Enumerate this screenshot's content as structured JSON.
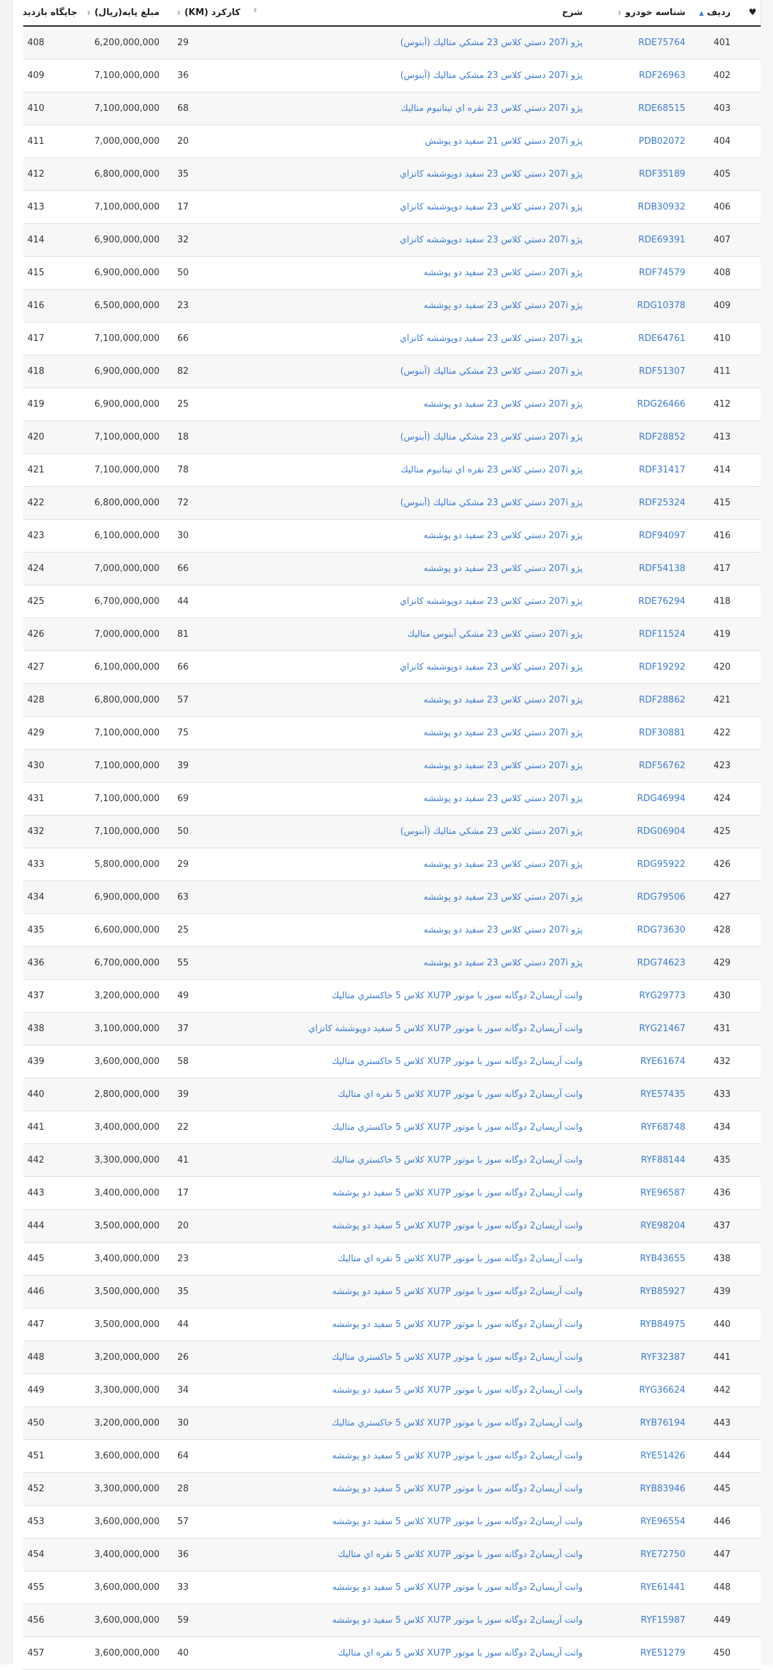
{
  "header": {
    "fav": "♥",
    "index": "ردیف",
    "code": "شناسه خودرو",
    "desc": "شرح",
    "km": "کارکرد (KM)",
    "price": "مبلغ پایه(ریال)",
    "rank": "جایگاه بازدید"
  },
  "colors": {
    "link": "#3a7bd5",
    "active_sort": "#3b7ad8"
  },
  "rows": [
    {
      "index": "401",
      "code": "RDE75764",
      "desc": "پژو 207i دستي كلاس 23 مشكي متاليك (آبنوس)",
      "km": "29",
      "price": "6,200,000,000",
      "rank": "408"
    },
    {
      "index": "402",
      "code": "RDF26963",
      "desc": "پژو 207i دستي كلاس 23 مشكي متاليك (آبنوس)",
      "km": "36",
      "price": "7,100,000,000",
      "rank": "409"
    },
    {
      "index": "403",
      "code": "RDE68515",
      "desc": "پژو 207i دستي كلاس 23 نقره اي تيتانيوم متاليك",
      "km": "68",
      "price": "7,100,000,000",
      "rank": "410"
    },
    {
      "index": "404",
      "code": "PDB02072",
      "desc": "پژو 207i دستي كلاس 21 سفيد دو پوشش",
      "km": "20",
      "price": "7,000,000,000",
      "rank": "411"
    },
    {
      "index": "405",
      "code": "RDF35189",
      "desc": "پژو 207i دستي كلاس 23 سفيد دوپوششه كانزاي",
      "km": "35",
      "price": "6,800,000,000",
      "rank": "412"
    },
    {
      "index": "406",
      "code": "RDB30932",
      "desc": "پژو 207i دستي كلاس 23 سفيد دوپوششه كانزاي",
      "km": "17",
      "price": "7,100,000,000",
      "rank": "413"
    },
    {
      "index": "407",
      "code": "RDE69391",
      "desc": "پژو 207i دستي كلاس 23 سفيد دوپوششه كانزاي",
      "km": "32",
      "price": "6,900,000,000",
      "rank": "414"
    },
    {
      "index": "408",
      "code": "RDF74579",
      "desc": "پژو 207i دستي كلاس 23 سفيد دو پوششه",
      "km": "50",
      "price": "6,900,000,000",
      "rank": "415"
    },
    {
      "index": "409",
      "code": "RDG10378",
      "desc": "پژو 207i دستي كلاس 23 سفيد دو پوششه",
      "km": "23",
      "price": "6,500,000,000",
      "rank": "416"
    },
    {
      "index": "410",
      "code": "RDE64761",
      "desc": "پژو 207i دستي كلاس 23 سفيد دوپوششه كانزاي",
      "km": "66",
      "price": "7,100,000,000",
      "rank": "417"
    },
    {
      "index": "411",
      "code": "RDF51307",
      "desc": "پژو 207i دستي كلاس 23 مشكي متاليك (آبنوس)",
      "km": "82",
      "price": "6,900,000,000",
      "rank": "418"
    },
    {
      "index": "412",
      "code": "RDG26466",
      "desc": "پژو 207i دستي كلاس 23 سفيد دو پوششه",
      "km": "25",
      "price": "6,900,000,000",
      "rank": "419"
    },
    {
      "index": "413",
      "code": "RDF28852",
      "desc": "پژو 207i دستي كلاس 23 مشكي متاليك (آبنوس)",
      "km": "18",
      "price": "7,100,000,000",
      "rank": "420"
    },
    {
      "index": "414",
      "code": "RDF31417",
      "desc": "پژو 207i دستي كلاس 23 نقره اي تيتانيوم متاليك",
      "km": "78",
      "price": "7,100,000,000",
      "rank": "421"
    },
    {
      "index": "415",
      "code": "RDF25324",
      "desc": "پژو 207i دستي كلاس 23 مشكي متاليك (آبنوس)",
      "km": "72",
      "price": "6,800,000,000",
      "rank": "422"
    },
    {
      "index": "416",
      "code": "RDF94097",
      "desc": "پژو 207i دستي كلاس 23 سفيد دو پوششه",
      "km": "30",
      "price": "6,100,000,000",
      "rank": "423"
    },
    {
      "index": "417",
      "code": "RDF54138",
      "desc": "پژو 207i دستي كلاس 23 سفيد دو پوششه",
      "km": "66",
      "price": "7,000,000,000",
      "rank": "424"
    },
    {
      "index": "418",
      "code": "RDE76294",
      "desc": "پژو 207i دستي كلاس 23 سفيد دوپوششه كانزاي",
      "km": "44",
      "price": "6,700,000,000",
      "rank": "425"
    },
    {
      "index": "419",
      "code": "RDF11524",
      "desc": "پژو 207i دستي كلاس 23 مشكي آبنوس متاليك",
      "km": "81",
      "price": "7,000,000,000",
      "rank": "426"
    },
    {
      "index": "420",
      "code": "RDF19292",
      "desc": "پژو 207i دستي كلاس 23 سفيد دوپوششه كانزاي",
      "km": "66",
      "price": "6,100,000,000",
      "rank": "427"
    },
    {
      "index": "421",
      "code": "RDF28862",
      "desc": "پژو 207i دستي كلاس 23 سفيد دو پوششه",
      "km": "57",
      "price": "6,800,000,000",
      "rank": "428"
    },
    {
      "index": "422",
      "code": "RDF30881",
      "desc": "پژو 207i دستي كلاس 23 سفيد دو پوششه",
      "km": "75",
      "price": "7,100,000,000",
      "rank": "429"
    },
    {
      "index": "423",
      "code": "RDF56762",
      "desc": "پژو 207i دستي كلاس 23 سفيد دو پوششه",
      "km": "39",
      "price": "7,100,000,000",
      "rank": "430"
    },
    {
      "index": "424",
      "code": "RDG46994",
      "desc": "پژو 207i دستي كلاس 23 سفيد دو پوششه",
      "km": "69",
      "price": "7,100,000,000",
      "rank": "431"
    },
    {
      "index": "425",
      "code": "RDG06904",
      "desc": "پژو 207i دستي كلاس 23 مشكي متاليك (آبنوس)",
      "km": "50",
      "price": "7,100,000,000",
      "rank": "432"
    },
    {
      "index": "426",
      "code": "RDG95922",
      "desc": "پژو 207i دستي كلاس 23 سفيد دو پوششه",
      "km": "29",
      "price": "5,800,000,000",
      "rank": "433"
    },
    {
      "index": "427",
      "code": "RDG79506",
      "desc": "پژو 207i دستي كلاس 23 سفيد دو پوششه",
      "km": "63",
      "price": "6,900,000,000",
      "rank": "434"
    },
    {
      "index": "428",
      "code": "RDG73630",
      "desc": "پژو 207i دستي كلاس 23 سفيد دو پوششه",
      "km": "25",
      "price": "6,600,000,000",
      "rank": "435"
    },
    {
      "index": "429",
      "code": "RDG74623",
      "desc": "پژو 207i دستي كلاس 23 سفيد دو پوششه",
      "km": "55",
      "price": "6,700,000,000",
      "rank": "436"
    },
    {
      "index": "430",
      "code": "RYG29773",
      "desc": "وانت آريسان2 دوگانه سوز با موتور XU7P كلاس 5 خاكستري متاليك",
      "km": "49",
      "price": "3,200,000,000",
      "rank": "437"
    },
    {
      "index": "431",
      "code": "RYG21467",
      "desc": "وانت آريسان2 دوگانه سوز با موتور XU7P كلاس 5 سفيد دوپوششه كانزاي",
      "km": "37",
      "price": "3,100,000,000",
      "rank": "438"
    },
    {
      "index": "432",
      "code": "RYE61674",
      "desc": "وانت آريسان2 دوگانه سوز با موتور XU7P كلاس 5 خاكستري متاليك",
      "km": "58",
      "price": "3,600,000,000",
      "rank": "439"
    },
    {
      "index": "433",
      "code": "RYE57435",
      "desc": "وانت آريسان2 دوگانه سوز با موتور XU7P كلاس 5 نقره اي متاليك",
      "km": "39",
      "price": "2,800,000,000",
      "rank": "440"
    },
    {
      "index": "434",
      "code": "RYF68748",
      "desc": "وانت آريسان2 دوگانه سوز با موتور XU7P كلاس 5 خاكستري متاليك",
      "km": "22",
      "price": "3,400,000,000",
      "rank": "441"
    },
    {
      "index": "435",
      "code": "RYF88144",
      "desc": "وانت آريسان2 دوگانه سوز با موتور XU7P كلاس 5 خاكستري متاليك",
      "km": "41",
      "price": "3,300,000,000",
      "rank": "442"
    },
    {
      "index": "436",
      "code": "RYE96587",
      "desc": "وانت آريسان2 دوگانه سوز با موتور XU7P كلاس 5 سفيد دو پوششه",
      "km": "17",
      "price": "3,400,000,000",
      "rank": "443"
    },
    {
      "index": "437",
      "code": "RYE98204",
      "desc": "وانت آريسان2 دوگانه سوز با موتور XU7P كلاس 5 سفيد دو پوششه",
      "km": "20",
      "price": "3,500,000,000",
      "rank": "444"
    },
    {
      "index": "438",
      "code": "RYB43655",
      "desc": "وانت آريسان2 دوگانه سوز با موتور XU7P كلاس 5 نقره اي متاليك",
      "km": "23",
      "price": "3,400,000,000",
      "rank": "445"
    },
    {
      "index": "439",
      "code": "RYB85927",
      "desc": "وانت آريسان2 دوگانه سوز با موتور XU7P كلاس 5 سفيد دو پوششه",
      "km": "35",
      "price": "3,500,000,000",
      "rank": "446"
    },
    {
      "index": "440",
      "code": "RYB84975",
      "desc": "وانت آريسان2 دوگانه سوز با موتور XU7P كلاس 5 سفيد دو پوششه",
      "km": "44",
      "price": "3,500,000,000",
      "rank": "447"
    },
    {
      "index": "441",
      "code": "RYF32387",
      "desc": "وانت آريسان2 دوگانه سوز با موتور XU7P كلاس 5 خاكستري متاليك",
      "km": "26",
      "price": "3,200,000,000",
      "rank": "448"
    },
    {
      "index": "442",
      "code": "RYG36624",
      "desc": "وانت آريسان2 دوگانه سوز با موتور XU7P كلاس 5 سفيد دو پوششه",
      "km": "34",
      "price": "3,300,000,000",
      "rank": "449"
    },
    {
      "index": "443",
      "code": "RYB76194",
      "desc": "وانت آريسان2 دوگانه سوز با موتور XU7P كلاس 5 خاكستري متاليك",
      "km": "30",
      "price": "3,200,000,000",
      "rank": "450"
    },
    {
      "index": "444",
      "code": "RYE51426",
      "desc": "وانت آريسان2 دوگانه سوز با موتور XU7P كلاس 5 سفيد دو پوششه",
      "km": "64",
      "price": "3,600,000,000",
      "rank": "451"
    },
    {
      "index": "445",
      "code": "RYB83946",
      "desc": "وانت آريسان2 دوگانه سوز با موتور XU7P كلاس 5 سفيد دو پوششه",
      "km": "28",
      "price": "3,300,000,000",
      "rank": "452"
    },
    {
      "index": "446",
      "code": "RYE96554",
      "desc": "وانت آريسان2 دوگانه سوز با موتور XU7P كلاس 5 سفيد دو پوششه",
      "km": "57",
      "price": "3,600,000,000",
      "rank": "453"
    },
    {
      "index": "447",
      "code": "RYE72750",
      "desc": "وانت آريسان2 دوگانه سوز با موتور XU7P كلاس 5 نقره اي متاليك",
      "km": "36",
      "price": "3,400,000,000",
      "rank": "454"
    },
    {
      "index": "448",
      "code": "RYE61441",
      "desc": "وانت آريسان2 دوگانه سوز با موتور XU7P كلاس 5 سفيد دو پوششه",
      "km": "33",
      "price": "3,600,000,000",
      "rank": "455"
    },
    {
      "index": "449",
      "code": "RYF15987",
      "desc": "وانت آريسان2 دوگانه سوز با موتور XU7P كلاس 5 سفيد دو پوششه",
      "km": "59",
      "price": "3,600,000,000",
      "rank": "456"
    },
    {
      "index": "450",
      "code": "RYE51279",
      "desc": "وانت آريسان2 دوگانه سوز با موتور XU7P كلاس 5 نقره اي متاليك",
      "km": "40",
      "price": "3,600,000,000",
      "rank": "457"
    }
  ]
}
